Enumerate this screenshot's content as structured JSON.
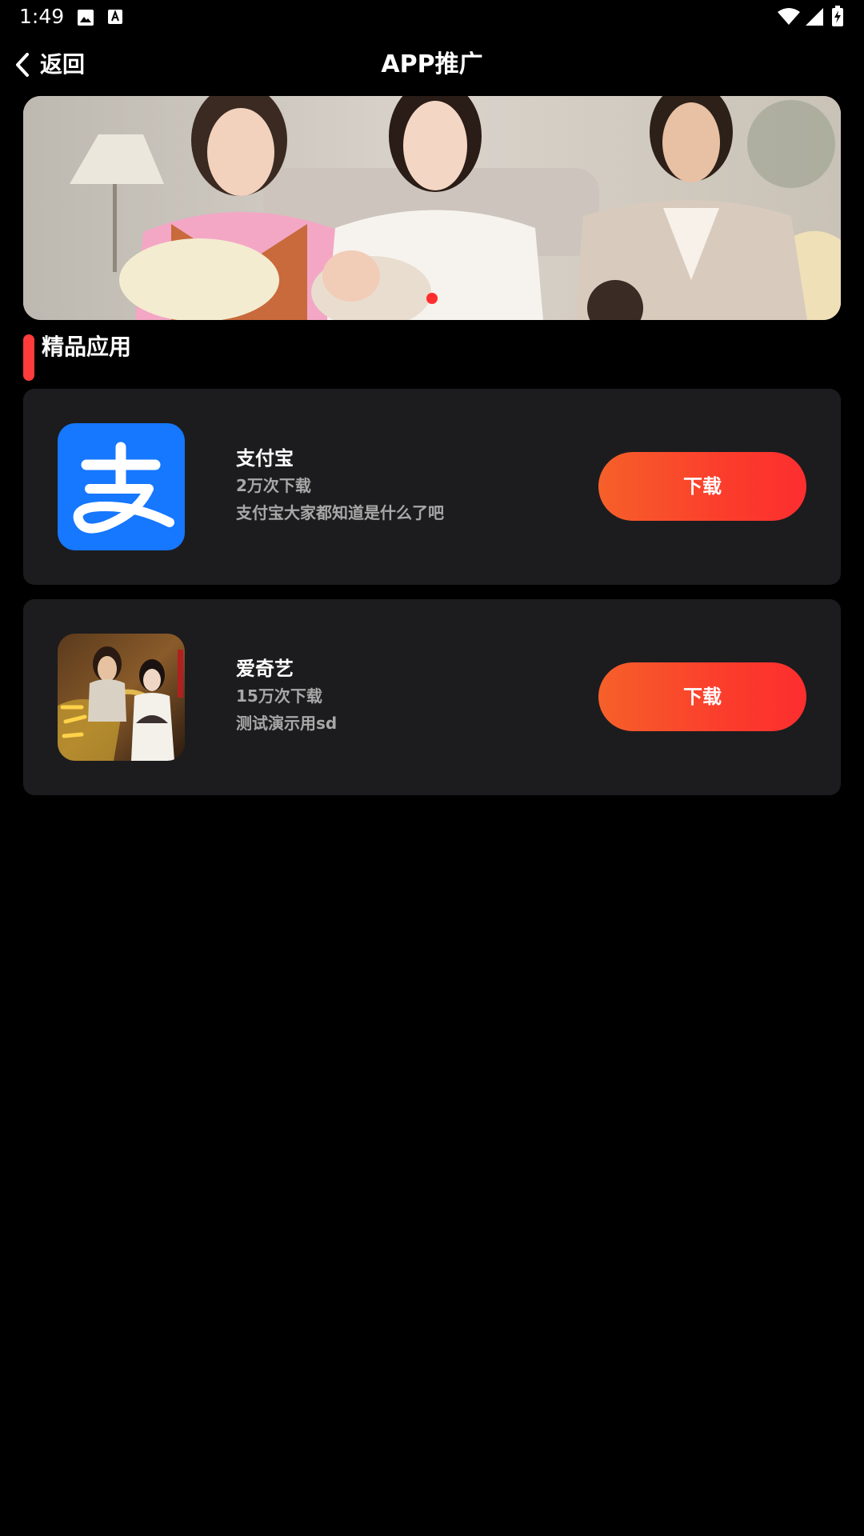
{
  "status_bar": {
    "time": "1:49",
    "icons": [
      "gallery-icon",
      "font-a-icon",
      "wifi-icon",
      "signal-icon",
      "battery-charging-icon"
    ]
  },
  "header": {
    "back_label": "返回",
    "back_icon": "chevron-left-icon",
    "title": "APP推广"
  },
  "banner": {
    "active_slide": 1,
    "indicator_color": "#ff2d2d"
  },
  "section": {
    "title": "精品应用",
    "accent_color": "#ff3b3b"
  },
  "apps": [
    {
      "name": "支付宝",
      "downloads": "2万次下载",
      "description": "支付宝大家都知道是什么了吧",
      "download_label": "下载",
      "icon": "alipay-logo-icon"
    },
    {
      "name": "爱奇艺",
      "downloads": "15万次下载",
      "description": "测试演示用sd",
      "download_label": "下载",
      "icon": "game-poster-icon"
    }
  ],
  "colors": {
    "background": "#000000",
    "card": "#1c1c1e",
    "button_gradient_start": "#f6602a",
    "button_gradient_end": "#fc2e2e",
    "secondary_text": "#a8a8a8",
    "alipay_blue": "#1677ff"
  }
}
